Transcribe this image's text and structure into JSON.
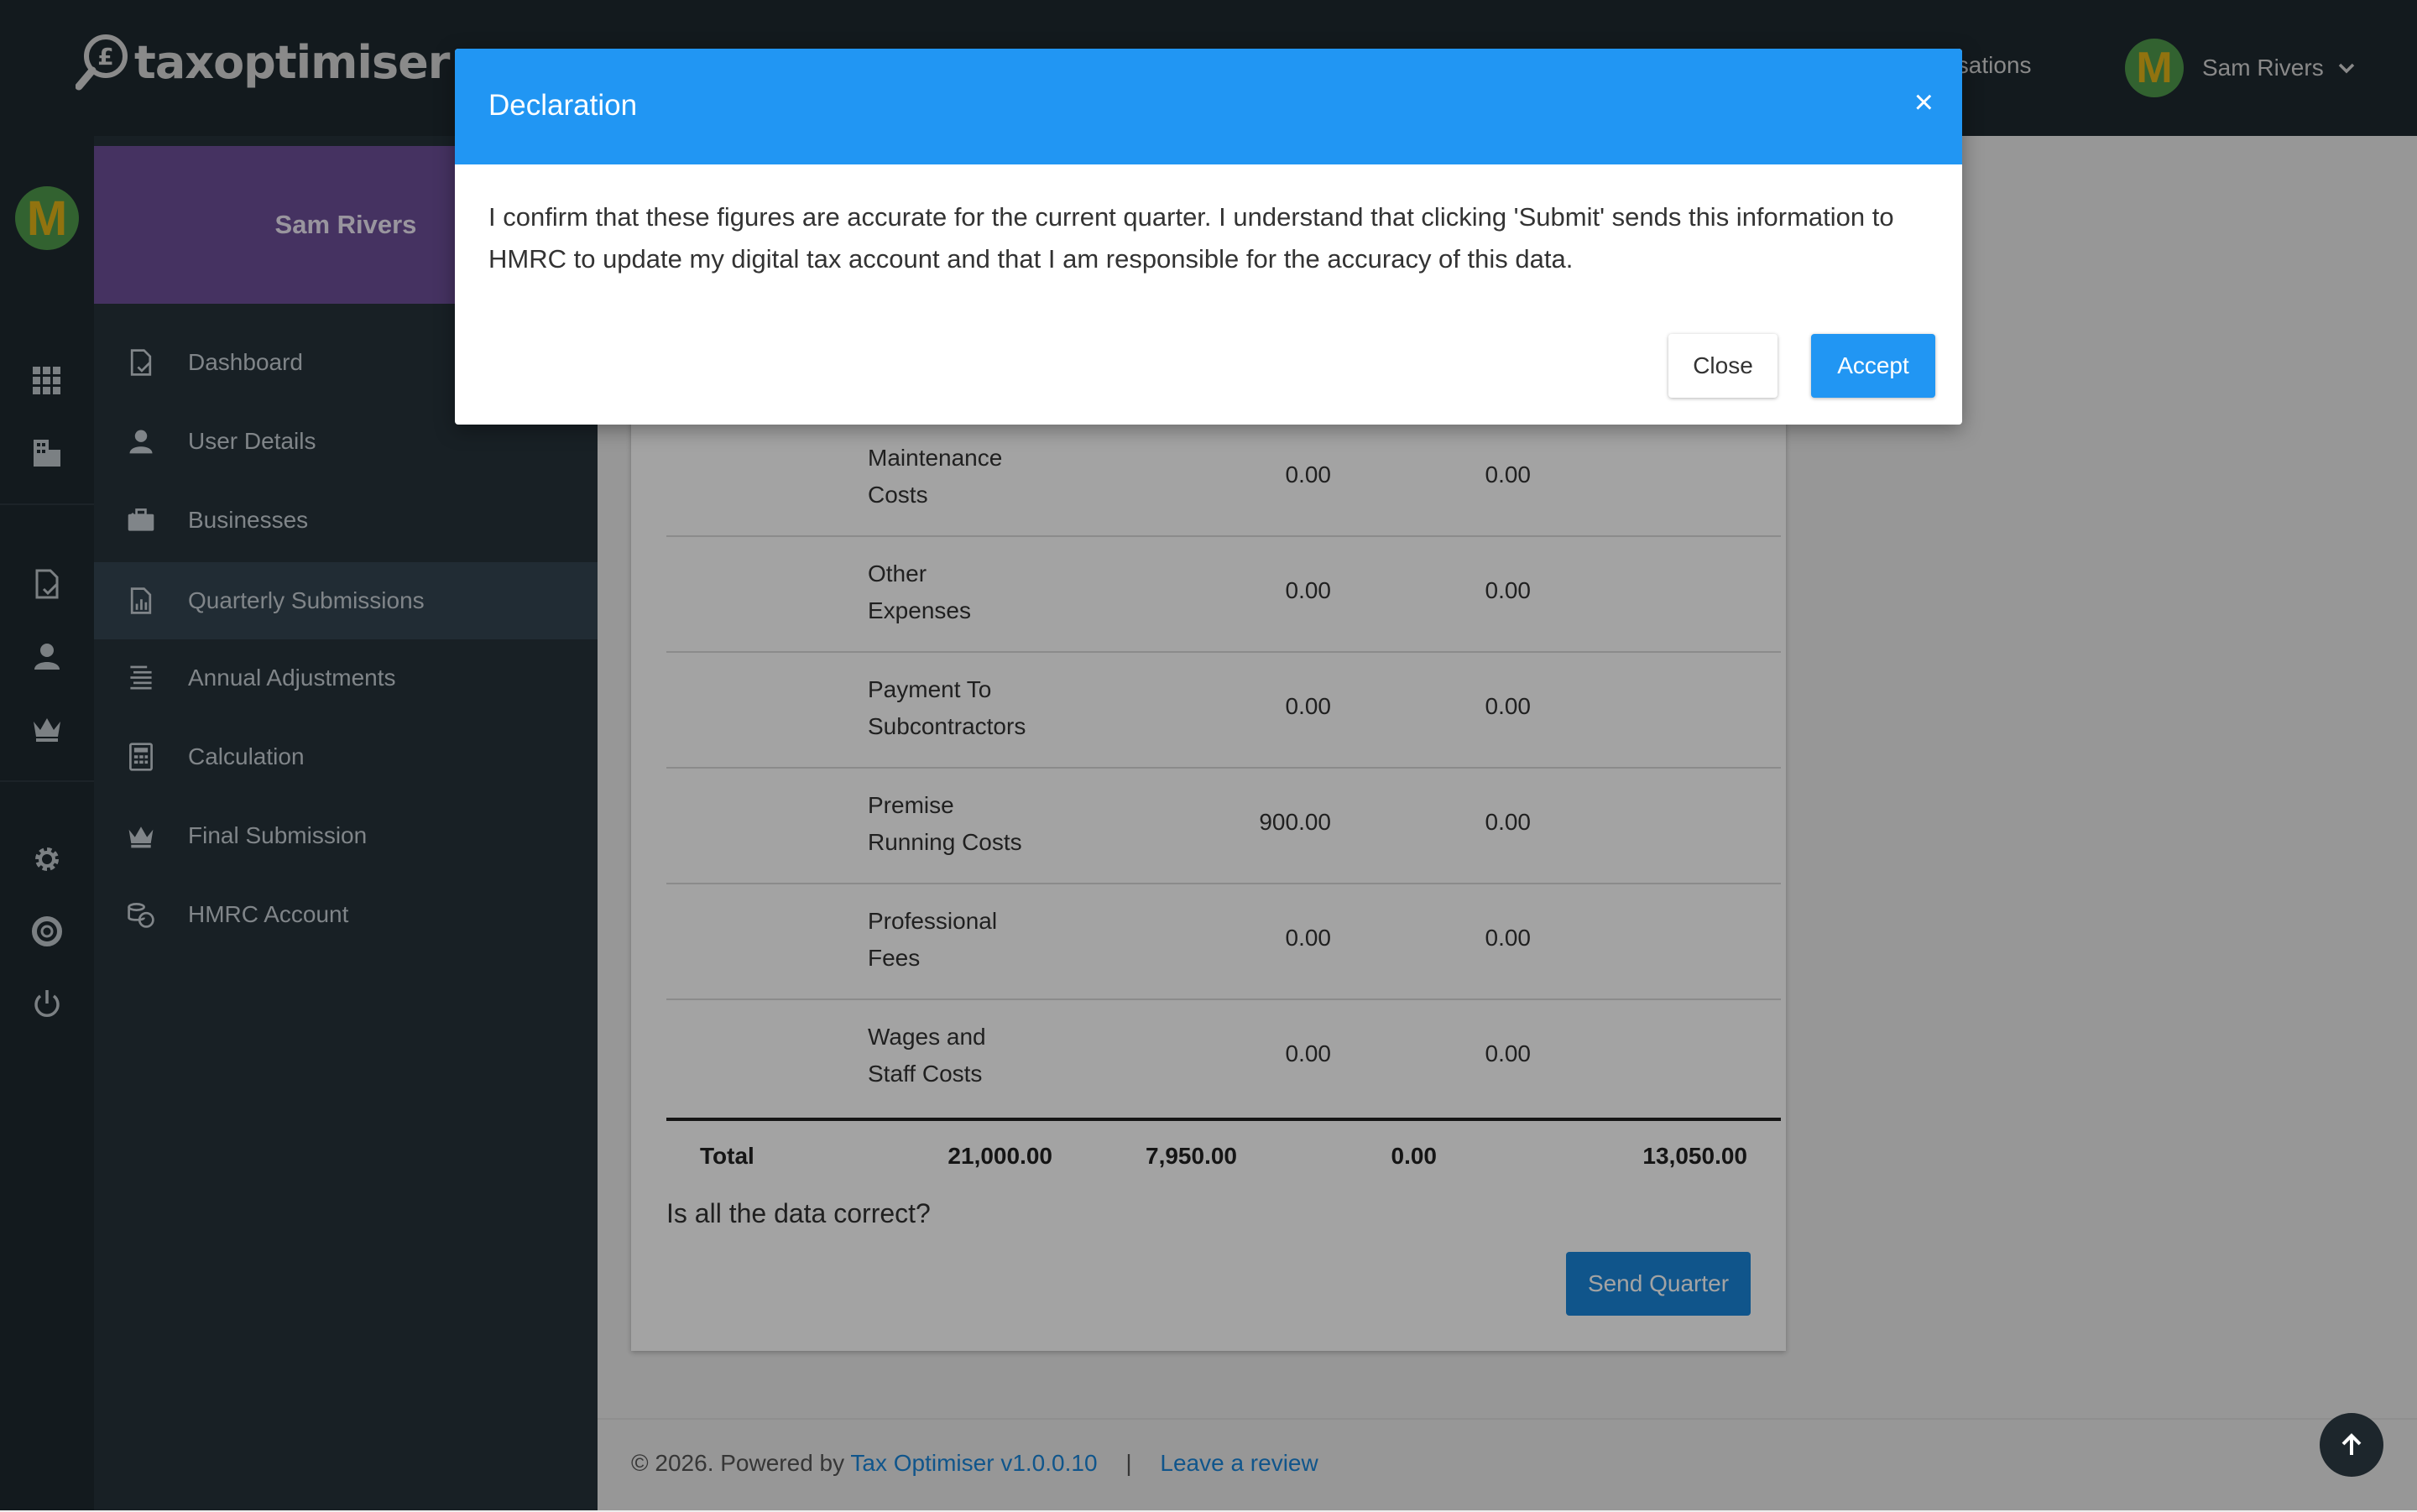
{
  "app": {
    "logo_text": "taxoptimiser"
  },
  "topbar": {
    "organisations_label": "nisations",
    "user_name": "Sam Rivers",
    "avatar_letter": "M"
  },
  "sidebar": {
    "profile_name": "Sam Rivers",
    "items": [
      {
        "label": "Dashboard",
        "icon": "document-check-icon"
      },
      {
        "label": "User Details",
        "icon": "user-icon"
      },
      {
        "label": "Businesses",
        "icon": "briefcase-icon"
      },
      {
        "label": "Quarterly Submissions",
        "icon": "report-icon",
        "active": true
      },
      {
        "label": "Annual Adjustments",
        "icon": "list-icon"
      },
      {
        "label": "Calculation",
        "icon": "calculator-icon"
      },
      {
        "label": "Final Submission",
        "icon": "crown-icon"
      },
      {
        "label": "HMRC Account",
        "icon": "coins-icon"
      }
    ]
  },
  "table": {
    "rows": [
      {
        "line1": "Maintenance",
        "line2": "Costs",
        "col3": "0.00",
        "col4": "0.00"
      },
      {
        "line1": "Other",
        "line2": "Expenses",
        "col3": "0.00",
        "col4": "0.00"
      },
      {
        "line1": "Payment To",
        "line2": "Subcontractors",
        "col3": "0.00",
        "col4": "0.00"
      },
      {
        "line1": "Premise",
        "line2": "Running Costs",
        "col3": "900.00",
        "col4": "0.00"
      },
      {
        "line1": "Professional",
        "line2": "Fees",
        "col3": "0.00",
        "col4": "0.00"
      },
      {
        "line1": "Wages and",
        "line2": "Staff Costs",
        "col3": "0.00",
        "col4": "0.00"
      }
    ],
    "total": {
      "label": "Total",
      "col1": "21,000.00",
      "col2": "7,950.00",
      "col3": "0.00",
      "col4": "13,050.00"
    }
  },
  "question": "Is all the data correct?",
  "send_button": "Send Quarter",
  "footer": {
    "prefix": "© 2026. Powered by ",
    "link1": "Tax Optimiser v1.0.0.10",
    "separator": "|",
    "link2": "Leave a review"
  },
  "modal": {
    "title": "Declaration",
    "close_x": "×",
    "body": "I confirm that these figures are accurate for the current quarter. I understand that clicking 'Submit' sends this information to HMRC to update my digital tax account and that I am responsible for the accuracy of this data.",
    "close_button": "Close",
    "accept_button": "Accept"
  }
}
